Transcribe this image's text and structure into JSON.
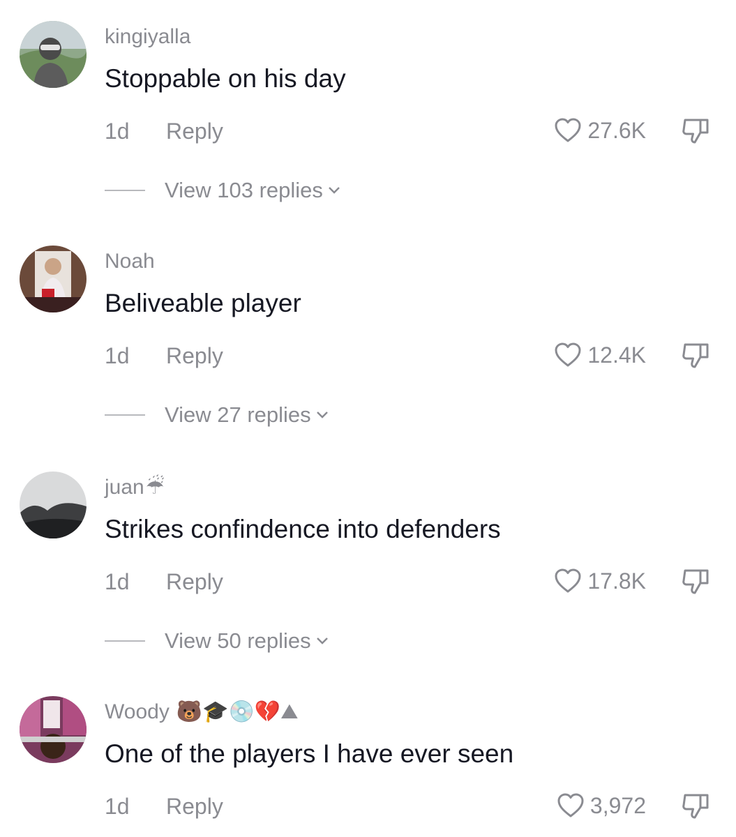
{
  "comments": [
    {
      "username": "kingiyalla",
      "emoji": "",
      "text": "Stoppable on his day",
      "age": "1d",
      "reply_label": "Reply",
      "likes": "27.6K",
      "view_replies": "View 103 replies"
    },
    {
      "username": "Noah",
      "emoji": "",
      "text": "Beliveable player",
      "age": "1d",
      "reply_label": "Reply",
      "likes": "12.4K",
      "view_replies": "View 27 replies"
    },
    {
      "username": "juan",
      "emoji": "☔",
      "text": "Strikes confindence into defenders",
      "age": "1d",
      "reply_label": "Reply",
      "likes": "17.8K",
      "view_replies": "View 50 replies"
    },
    {
      "username": "Woody",
      "emoji": "🐻🎓💿💔⛰",
      "text": "One of the players I have ever seen",
      "age": "1d",
      "reply_label": "Reply",
      "likes": "3,972",
      "view_replies": ""
    }
  ],
  "colors": {
    "text_primary": "#161823",
    "text_secondary": "#8a8b91",
    "background": "#ffffff"
  },
  "icons": {
    "like": "heart-outline-icon",
    "dislike": "thumbs-down-outline-icon",
    "expand": "chevron-down-icon"
  }
}
